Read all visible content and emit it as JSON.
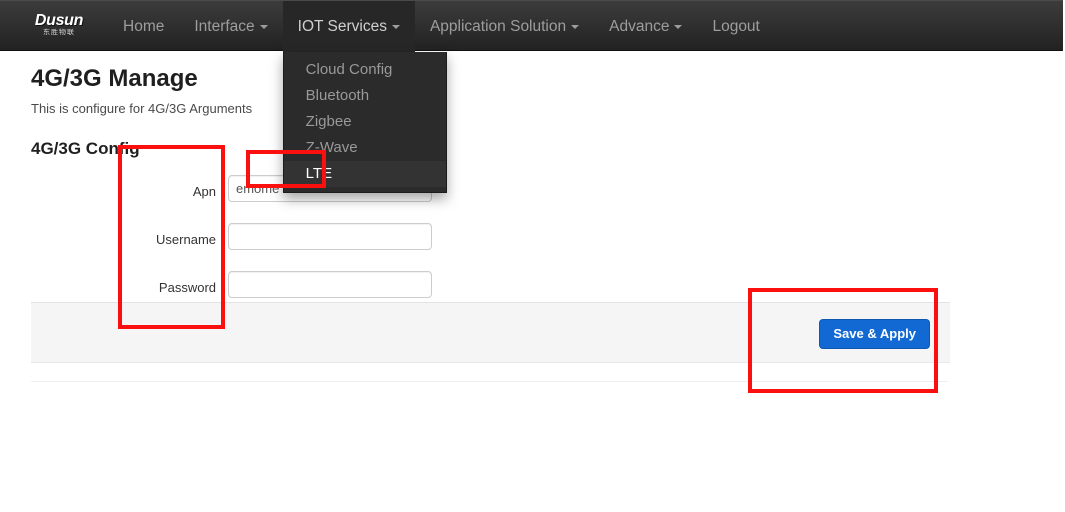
{
  "brand": {
    "name": "Dusun",
    "sub": "东胜物联"
  },
  "nav": {
    "items": [
      {
        "label": "Home",
        "caret": false
      },
      {
        "label": "Interface",
        "caret": true
      },
      {
        "label": "IOT Services",
        "caret": true
      },
      {
        "label": "Application Solution",
        "caret": true
      },
      {
        "label": "Advance",
        "caret": true
      },
      {
        "label": "Logout",
        "caret": false
      }
    ],
    "dropdown": {
      "owner": "IOT Services",
      "items": [
        {
          "label": "Cloud Config",
          "active": false
        },
        {
          "label": "Bluetooth",
          "active": false
        },
        {
          "label": "Zigbee",
          "active": false
        },
        {
          "label": "Z-Wave",
          "active": false
        },
        {
          "label": "LTE",
          "active": true
        }
      ]
    }
  },
  "page": {
    "title": "4G/3G Manage",
    "subtitle": "This is configure for 4G/3G Arguments",
    "section_title": "4G/3G Config"
  },
  "form": {
    "fields": [
      {
        "label": "Apn",
        "value": "emome",
        "placeholder": "",
        "type": "text"
      },
      {
        "label": "Username",
        "value": "",
        "placeholder": "",
        "type": "text"
      },
      {
        "label": "Password",
        "value": "",
        "placeholder": "",
        "type": "text"
      }
    ]
  },
  "actions": {
    "save_label": "Save & Apply"
  },
  "annotations": {
    "fields_box": "highlight-form-fields",
    "lte_box": "highlight-lte-menu-item",
    "save_box": "highlight-save-apply"
  },
  "colors": {
    "navbar_top": "#3c3c3c",
    "navbar_bottom": "#222222",
    "nav_text": "#9d9d9d",
    "dropdown_bg": "#2b2b2b",
    "dropdown_active_text": "#ffffff",
    "primary_button": "#1269d3",
    "annotation_red": "#fb0f0f",
    "panel_bg": "#f5f5f5"
  }
}
